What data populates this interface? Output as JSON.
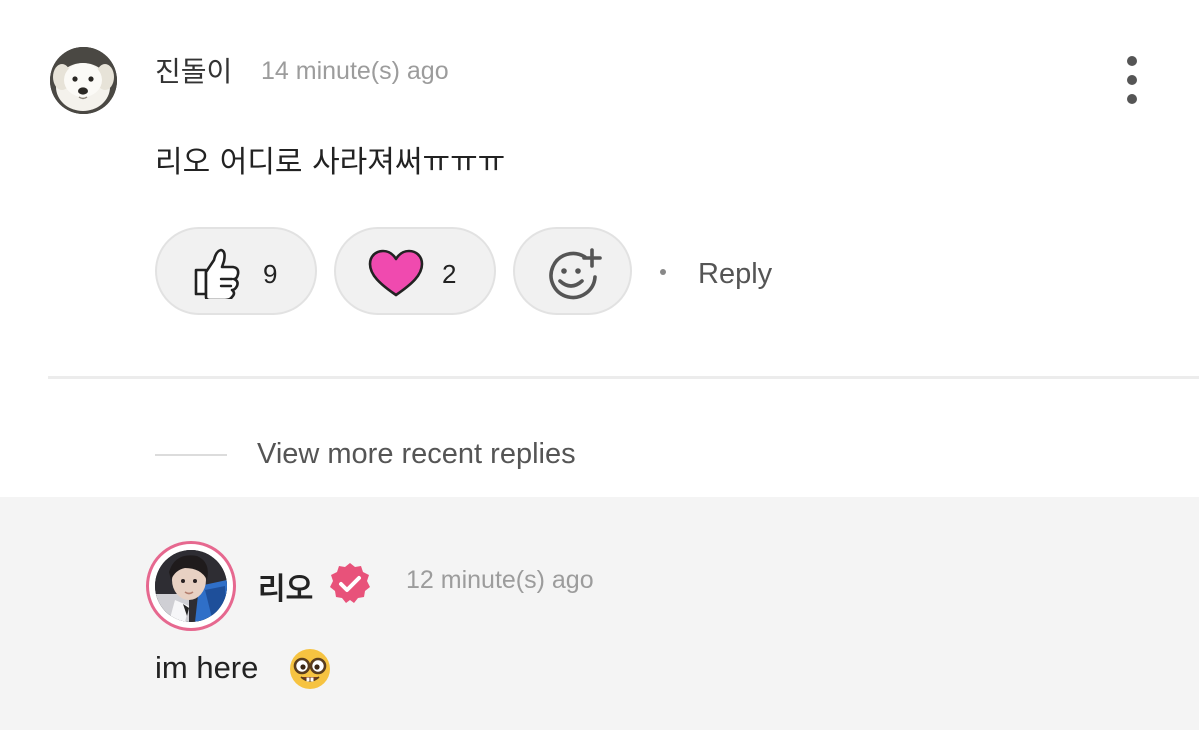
{
  "comment": {
    "username": "진돌이",
    "timestamp": "14 minute(s) ago",
    "text": "리오 어디로 사라져써ㅠㅠㅠ",
    "reactions": {
      "like_count": "9",
      "love_count": "2"
    },
    "separator": "·",
    "reply_label": "Reply",
    "icons": {
      "avatar": "dog-avatar",
      "menu": "more-vertical-icon",
      "like": "thumbs-up-icon",
      "love": "heart-icon",
      "add_reaction": "add-reaction-icon"
    },
    "colors": {
      "heart": "#f04aaf",
      "timestamp": "#9c9c9c"
    }
  },
  "thread": {
    "view_more_label": "View more recent replies"
  },
  "reply": {
    "username": "리오",
    "timestamp": "12 minute(s) ago",
    "text": "im here",
    "emoji": "nerd-face",
    "icons": {
      "badge": "verified-badge-icon",
      "avatar": "user-avatar"
    },
    "colors": {
      "badge": "#e8527a",
      "ring": "#e6688f",
      "background": "#f4f4f4"
    }
  }
}
